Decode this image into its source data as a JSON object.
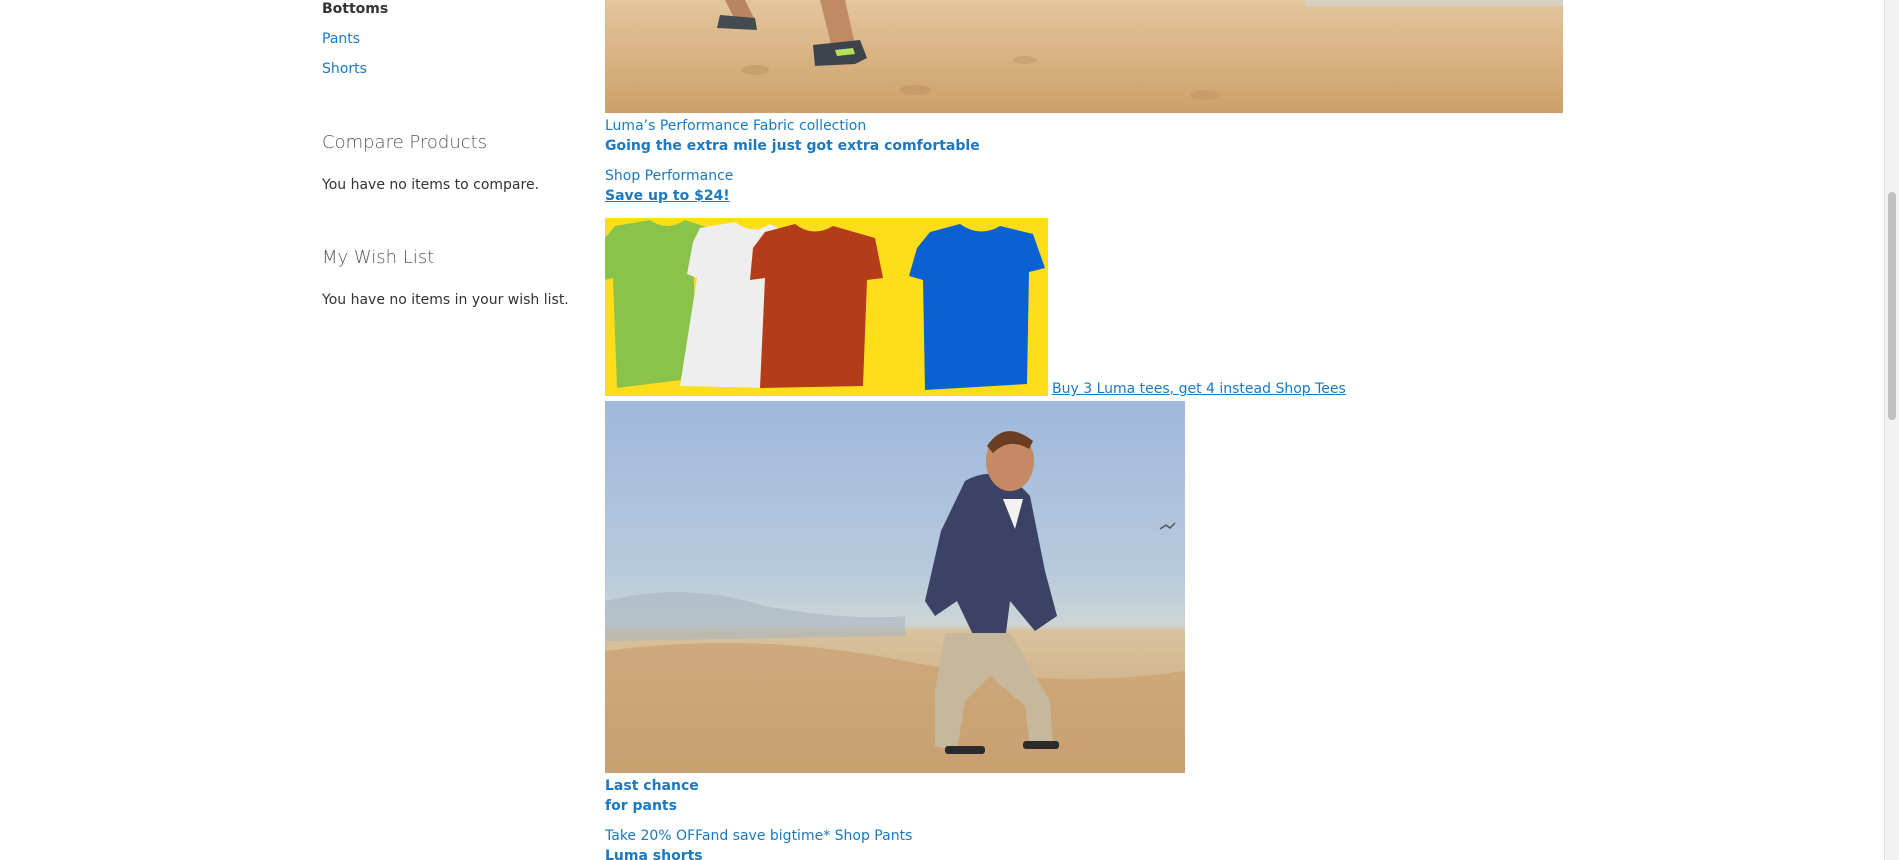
{
  "sidebar": {
    "category_heading": "Bottoms",
    "category_links": [
      "Pants",
      "Shorts"
    ],
    "compare": {
      "title": "Compare Products",
      "empty_text": "You have no items to compare."
    },
    "wishlist": {
      "title": "My Wish List",
      "empty_text": "You have no items in your wish list."
    }
  },
  "main": {
    "performance": {
      "collection_link": "Luma’s Performance Fabric collection",
      "tagline": "Going the extra mile just got extra comfortable",
      "shop_link": "Shop Performance",
      "save_text": "Save up to $24!"
    },
    "tees": {
      "caption": " Buy 3 Luma tees, get 4 instead Shop Tees",
      "tee_colors": [
        "#8bc34a",
        "#eeeeee",
        "#b33d1b",
        "#0a62d2"
      ]
    },
    "pants": {
      "headline_line1": "Last chance",
      "headline_line2": "for pants",
      "offer_text": "Take 20% OFFand save bigtime* Shop Pants",
      "next_heading": "Luma shorts"
    }
  },
  "colors": {
    "link": "#1979c3",
    "text": "#333333",
    "block_title": "#575757",
    "tees_background": "#fedd1a"
  }
}
